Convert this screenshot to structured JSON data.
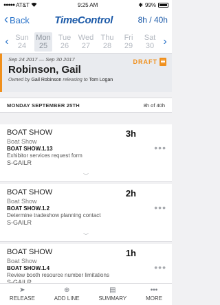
{
  "status_bar": {
    "carrier": "AT&T",
    "time": "9:25 AM",
    "battery": "99%"
  },
  "nav": {
    "back_label": "Back",
    "app_title": "TimeControl",
    "hours": "8h / 40h"
  },
  "week": {
    "days": [
      {
        "name": "Sun",
        "date": "24"
      },
      {
        "name": "Mon",
        "date": "25"
      },
      {
        "name": "Tue",
        "date": "26"
      },
      {
        "name": "Wed",
        "date": "27"
      },
      {
        "name": "Thu",
        "date": "28"
      },
      {
        "name": "Fri",
        "date": "29"
      },
      {
        "name": "Sat",
        "date": "30"
      }
    ],
    "selected_index": 1
  },
  "timesheet": {
    "dates": "Sep 24 2017 — Sep 30 2017",
    "name": "Robinson, Gail",
    "owned_by_label": "Owned by",
    "owner": "Gail Robinson",
    "releasing_to_label": "releasing to",
    "release_to": "Tom Logan",
    "status": "DRAFT"
  },
  "day_header": {
    "title": "MONDAY SEPTEMBER 25TH",
    "hours": "8h of 40h"
  },
  "entries": [
    {
      "title": "BOAT SHOW",
      "client": "Boat Show",
      "task_code": "BOAT SHOW.1.13",
      "description": "Exhibitor services request form",
      "resource": "S-GAILR",
      "hours": "3h"
    },
    {
      "title": "BOAT SHOW",
      "client": "Boat Show",
      "task_code": "BOAT SHOW.1.2",
      "description": "Determine tradeshow planning contact",
      "resource": "S-GAILR",
      "hours": "2h"
    },
    {
      "title": "BOAT SHOW",
      "client": "Boat Show",
      "task_code": "BOAT SHOW.1.4",
      "description": "Review booth resource number limitations",
      "resource": "S-GAILR",
      "hours": "1h"
    }
  ],
  "tabs": {
    "release": "RELEASE",
    "add_line": "ADD LINE",
    "summary": "SUMMARY",
    "more": "MORE"
  },
  "colors": {
    "brand_blue": "#1c5aa8",
    "link_blue": "#2a73c9",
    "draft_orange": "#f0901d"
  }
}
